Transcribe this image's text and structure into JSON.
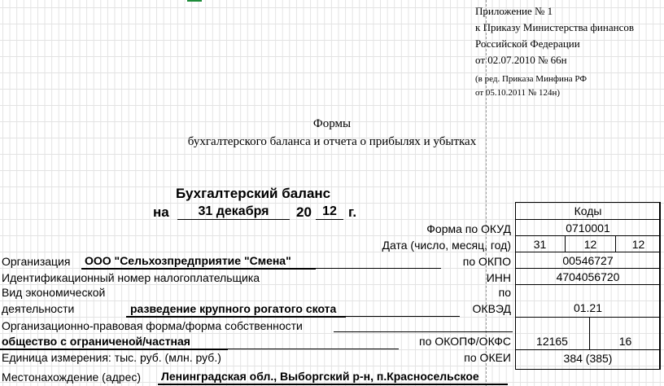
{
  "annex": {
    "line1": "Приложение № 1",
    "line2": "к Приказу Министерства финансов",
    "line3": "Российской Федерации",
    "line4": "от  02.07.2010 № 66н",
    "note1": "(в ред. Приказа Минфина РФ",
    "note2": "от 05.10.2011 № 124н)"
  },
  "forms_title": {
    "line1": "Формы",
    "line2": "бухгалтерского баланса и отчета о прибылях и убытках"
  },
  "balance": {
    "title": "Бухгалтерский баланс",
    "prefix": "на",
    "date": "31 декабря",
    "year_prefix": "20",
    "year_suffix": "12",
    "year_unit": "г."
  },
  "codes": {
    "header": "Коды",
    "okud": "0710001",
    "date_day": "31",
    "date_month": "12",
    "date_year": "12",
    "okpo": "00546727",
    "inn": "4704056720",
    "okved": "01.21",
    "okopf": "12165",
    "okfs": "16",
    "okei": "384 (385)"
  },
  "labels": {
    "okud": "Форма по ОКУД",
    "date": "Дата (число, месяц, год)",
    "org": "Организация",
    "okpo": "по ОКПО",
    "inn_long": "Идентификационный номер налогоплательщика",
    "inn": "ИНН",
    "activity1": "Вид экономической",
    "activity2": "деятельности",
    "po": "по",
    "okved": "ОКВЭД",
    "legal_form": "Организационно-правовая форма/форма собственности",
    "okopf": "по ОКОПФ/ОКФС",
    "unit": "Единица измерения: тыс. руб. (млн. руб.)",
    "okei": "по ОКЕИ",
    "address": "Местонахождение (адрес)"
  },
  "values": {
    "org": "ООО \"Сельхозпредприятие \"Смена\"",
    "activity": "разведение крупного рогатого скота",
    "legal_form": "общество с ограниченой/частная",
    "address": "Ленинградская обл., Выборгский р-н,  п.Красносельское"
  }
}
